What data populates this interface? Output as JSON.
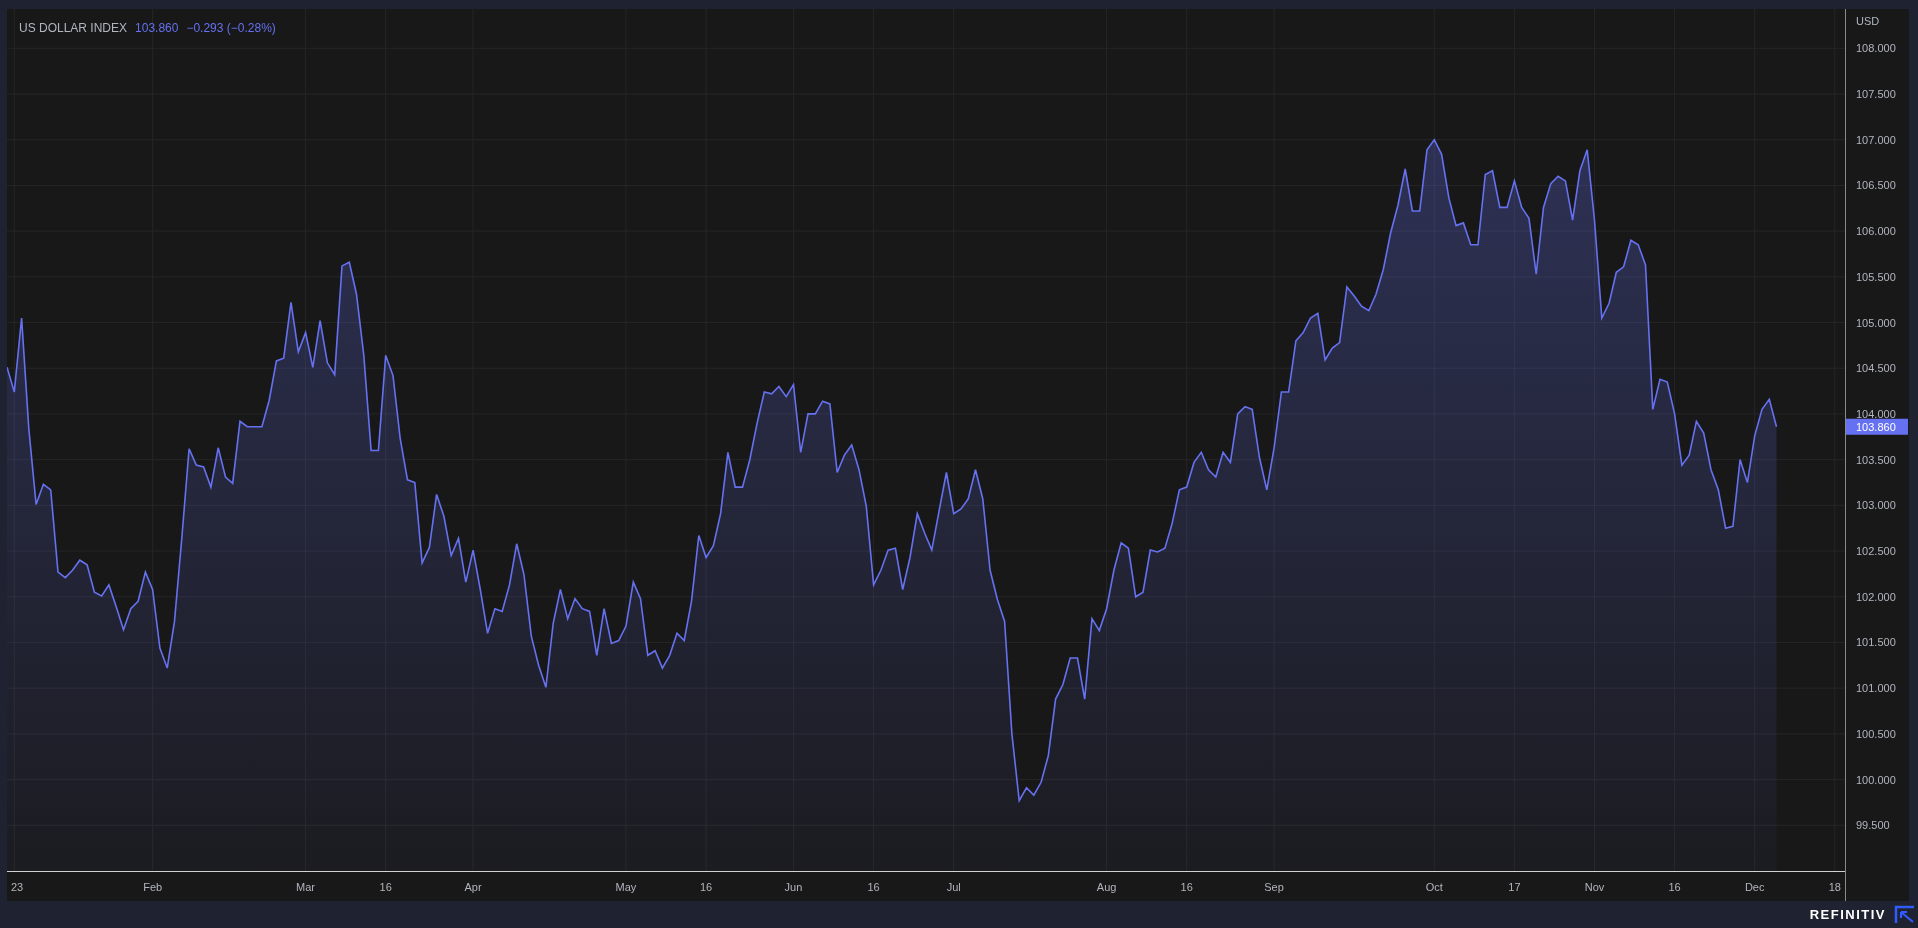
{
  "legend": {
    "value": "103.860",
    "change": "−0.293 (−0.28%)"
  },
  "chart": {
    "last_price_label": "103.860",
    "chart_data": {
      "type": "area",
      "ylabel": "USD",
      "grid": true,
      "ylim": [
        99.0,
        108.43
      ],
      "categories": [
        null,
        "23",
        null,
        null,
        null,
        null,
        null,
        null,
        null,
        null,
        null,
        null,
        null,
        null,
        null,
        null,
        null,
        null,
        null,
        null,
        "Feb",
        null,
        null,
        null,
        null,
        null,
        null,
        null,
        null,
        null,
        null,
        null,
        null,
        null,
        null,
        null,
        null,
        null,
        null,
        null,
        null,
        "Mar",
        null,
        null,
        null,
        null,
        null,
        null,
        null,
        null,
        null,
        null,
        "16",
        null,
        null,
        null,
        null,
        null,
        null,
        null,
        null,
        null,
        null,
        null,
        "Apr",
        null,
        null,
        null,
        null,
        null,
        null,
        null,
        null,
        null,
        null,
        null,
        null,
        null,
        null,
        null,
        null,
        null,
        null,
        null,
        null,
        "May",
        null,
        null,
        null,
        null,
        null,
        null,
        null,
        null,
        null,
        null,
        "16",
        null,
        null,
        null,
        null,
        null,
        null,
        null,
        null,
        null,
        null,
        null,
        "Jun",
        null,
        null,
        null,
        null,
        null,
        null,
        null,
        null,
        null,
        null,
        "16",
        null,
        null,
        null,
        null,
        null,
        null,
        null,
        null,
        null,
        null,
        "Jul",
        null,
        null,
        null,
        null,
        null,
        null,
        null,
        null,
        null,
        null,
        null,
        null,
        null,
        null,
        null,
        null,
        null,
        null,
        null,
        null,
        "Aug",
        null,
        null,
        null,
        null,
        null,
        null,
        null,
        null,
        null,
        null,
        "16",
        null,
        null,
        null,
        null,
        null,
        null,
        null,
        null,
        null,
        null,
        null,
        "Sep",
        null,
        null,
        null,
        null,
        null,
        null,
        null,
        null,
        null,
        null,
        null,
        null,
        null,
        null,
        null,
        null,
        null,
        null,
        null,
        null,
        null,
        "Oct",
        null,
        null,
        null,
        null,
        null,
        null,
        null,
        null,
        null,
        null,
        "17",
        null,
        null,
        null,
        null,
        null,
        null,
        null,
        null,
        null,
        null,
        "Nov",
        null,
        null,
        null,
        null,
        null,
        null,
        null,
        null,
        null,
        null,
        "16",
        null,
        null,
        null,
        null,
        null,
        null,
        null,
        null,
        null,
        null,
        "Dec",
        null,
        null,
        null,
        null,
        null,
        null,
        null,
        null,
        null,
        null,
        "18",
        null
      ],
      "yticks": [
        {
          "value": 99.5,
          "label": "99.500"
        },
        {
          "value": 100,
          "label": "100.000"
        },
        {
          "value": 100.5,
          "label": "100.500"
        },
        {
          "value": 101,
          "label": "101.000"
        },
        {
          "value": 101.5,
          "label": "101.500"
        },
        {
          "value": 102,
          "label": "102.000"
        },
        {
          "value": 102.5,
          "label": "102.500"
        },
        {
          "value": 103,
          "label": "103.000"
        },
        {
          "value": 103.5,
          "label": "103.500"
        },
        {
          "value": 104,
          "label": "104.000"
        },
        {
          "value": 104.5,
          "label": "104.500"
        },
        {
          "value": 105,
          "label": "105.000"
        },
        {
          "value": 105.5,
          "label": "105.500"
        },
        {
          "value": 106,
          "label": "106.000"
        },
        {
          "value": 106.5,
          "label": "106.500"
        },
        {
          "value": 107,
          "label": "107.000"
        },
        {
          "value": 107.5,
          "label": "107.500"
        },
        {
          "value": 108,
          "label": "108.000"
        }
      ],
      "series": [
        {
          "name": "US DOLLAR INDEX",
          "color": "#6571f0",
          "values": [
            104.51,
            104.24,
            105.05,
            103.84,
            103.01,
            103.23,
            103.17,
            102.27,
            102.21,
            102.29,
            102.4,
            102.35,
            102.05,
            102.01,
            102.13,
            101.89,
            101.64,
            101.87,
            101.95,
            102.27,
            102.08,
            101.44,
            101.22,
            101.73,
            102.64,
            103.62,
            103.44,
            103.42,
            103.2,
            103.63,
            103.31,
            103.24,
            103.92,
            103.86,
            103.86,
            103.86,
            104.15,
            104.58,
            104.61,
            105.22,
            104.68,
            104.89,
            104.51,
            105.02,
            104.56,
            104.43,
            105.62,
            105.66,
            105.31,
            104.64,
            103.6,
            103.6,
            104.64,
            104.42,
            103.73,
            103.28,
            103.25,
            102.37,
            102.54,
            103.12,
            102.88,
            102.45,
            102.64,
            102.16,
            102.51,
            102.08,
            101.6,
            101.87,
            101.84,
            102.13,
            102.58,
            102.24,
            101.57,
            101.25,
            101.01,
            101.71,
            102.08,
            101.76,
            101.98,
            101.87,
            101.84,
            101.36,
            101.87,
            101.49,
            101.52,
            101.68,
            102.16,
            101.98,
            101.36,
            101.41,
            101.22,
            101.36,
            101.6,
            101.52,
            101.95,
            102.67,
            102.43,
            102.56,
            102.91,
            103.58,
            103.2,
            103.2,
            103.5,
            103.9,
            104.24,
            104.22,
            104.3,
            104.19,
            104.32,
            103.58,
            104.0,
            104.0,
            104.14,
            104.11,
            103.36,
            103.55,
            103.66,
            103.39,
            102.99,
            102.13,
            102.29,
            102.51,
            102.53,
            102.08,
            102.43,
            102.91,
            102.7,
            102.51,
            102.94,
            103.36,
            102.91,
            102.96,
            103.07,
            103.39,
            103.07,
            102.29,
            101.97,
            101.73,
            100.5,
            99.77,
            99.91,
            99.83,
            99.97,
            100.26,
            100.88,
            101.04,
            101.33,
            101.33,
            100.88,
            101.76,
            101.63,
            101.87,
            102.29,
            102.59,
            102.53,
            102.0,
            102.05,
            102.51,
            102.49,
            102.53,
            102.8,
            103.17,
            103.2,
            103.47,
            103.58,
            103.39,
            103.31,
            103.58,
            103.47,
            104.0,
            104.08,
            104.05,
            103.52,
            103.17,
            103.63,
            104.24,
            104.24,
            104.8,
            104.89,
            105.05,
            105.1,
            104.59,
            104.72,
            104.78,
            105.39,
            105.29,
            105.18,
            105.13,
            105.31,
            105.58,
            105.98,
            106.28,
            106.68,
            106.22,
            106.22,
            106.89,
            107.0,
            106.84,
            106.36,
            106.06,
            106.09,
            105.85,
            105.85,
            106.62,
            106.66,
            106.26,
            106.26,
            106.55,
            106.26,
            106.14,
            105.53,
            106.26,
            106.52,
            106.6,
            106.55,
            106.12,
            106.66,
            106.89,
            106.12,
            105.05,
            105.21,
            105.55,
            105.61,
            105.9,
            105.85,
            105.63,
            104.05,
            104.38,
            104.35,
            104.0,
            103.44,
            103.55,
            103.92,
            103.79,
            103.39,
            103.17,
            102.75,
            102.77,
            103.5,
            103.25,
            103.76,
            104.05,
            104.16,
            103.86,
            null,
            null,
            null,
            null,
            null,
            null,
            null,
            null,
            null
          ]
        }
      ]
    }
  },
  "footer": {
    "brand": "REFINITIV"
  }
}
